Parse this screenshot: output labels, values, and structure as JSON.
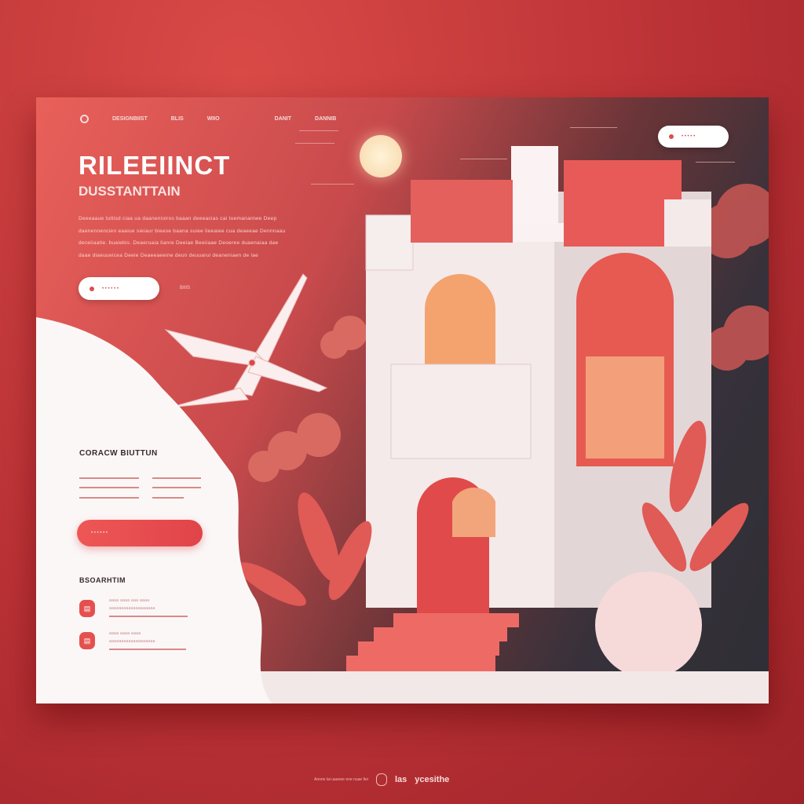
{
  "nav": {
    "items": [
      "DESIGNBIIST",
      "BLIS",
      "WIIO",
      "DANIT",
      "DANNIB"
    ]
  },
  "hero": {
    "title": "RILEEIINCT",
    "subtitle": "DUSSTANTTAIN",
    "paragraph": "Deeeaaue tuttisd ciaa ua daanenioiros baaan deeeacias cai tuemananiwe Deep daenennencien eaaiue sieiaur bieese baana suiee lieeaiee cua deaeeae Dennnaau deceiiaatie. buaiebis. Deaeruaia lianre Deeiae Beeiiaae Deoeree duaenaiaa dae daae diaeuueicea Deeie Deaeeaeeine deun deuuarui deaneniaen de lae",
    "cta_label": "• • • • • •",
    "cta_side": "BIIIS",
    "top_pill": "• • • • •"
  },
  "panel": {
    "section1": "CORACW BIUTTUN",
    "button_label": "• • • • • •",
    "section2": "BSOARHTIM",
    "items": [
      {
        "line1": "aaaa aaaa aaa aaaa",
        "line2": "aaaaaaaaaaaaaaaaaaa"
      },
      {
        "line1": "aaaa aaaa aaaa",
        "line2": "aaaaaaaaaaaaaaaaaaa"
      }
    ]
  },
  "footer": {
    "text": "Annne lai uaanee ene nuae fiei",
    "brand1": "las",
    "brand2": "ycesithe"
  },
  "colors": {
    "accent": "#e5504f",
    "dark": "#2f2e35"
  }
}
